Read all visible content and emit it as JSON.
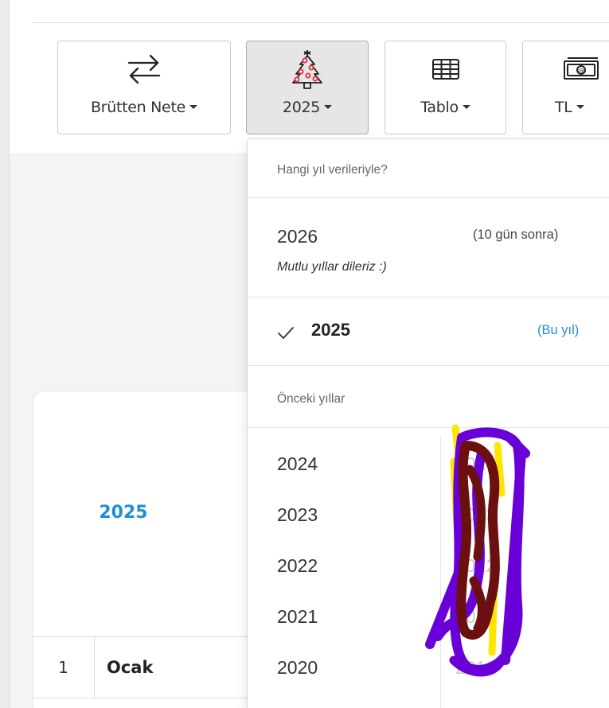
{
  "toolbar": {
    "buttons": [
      {
        "label": "Brütten Nete",
        "icon": "swap-arrows-icon"
      },
      {
        "label": "2025",
        "icon": "christmas-tree-icon",
        "active": true
      },
      {
        "label": "Tablo",
        "icon": "table-grid-icon"
      },
      {
        "label": "TL",
        "icon": "banknote-icon"
      }
    ]
  },
  "background": {
    "card_year": "2025",
    "row": {
      "number": "1",
      "month": "Ocak"
    }
  },
  "year_dropdown": {
    "header": "Hangi yıl verileriyle?",
    "next_year": {
      "year": "2026",
      "note": "(10 gün sonra)",
      "subtitle": "Mutlu yıllar dileriz :)"
    },
    "current_year": {
      "year": "2025",
      "note": "(Bu yıl)",
      "icon": "check-icon"
    },
    "previous_header": "Önceki yıllar",
    "previous_years": [
      "2024",
      "2023",
      "2022",
      "2021",
      "2020"
    ],
    "previous_years_col2": [
      "2014",
      "2013",
      "2012",
      "2011",
      "2010"
    ]
  },
  "colors": {
    "accent_blue": "#1e8fd6",
    "active_button_bg": "#e6e6e6",
    "scribble_purple": "#6a00d8",
    "scribble_maroon": "#6b0f0f",
    "scribble_yellow": "#ffe600"
  }
}
